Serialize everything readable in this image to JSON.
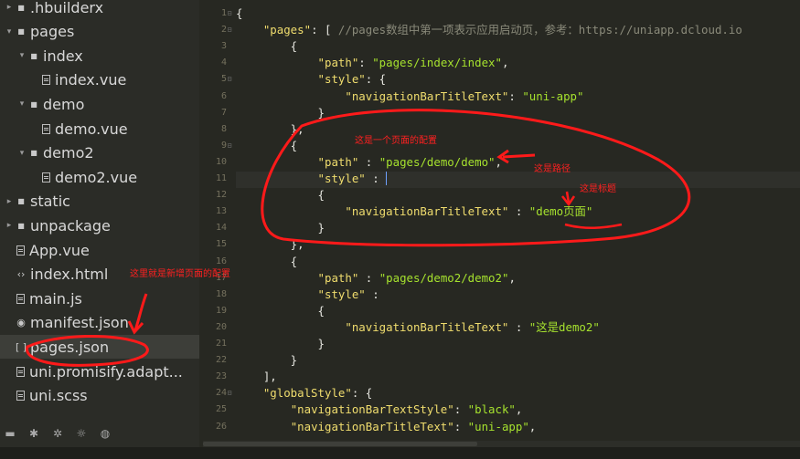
{
  "sidebar": {
    "items": [
      {
        "label": ".hbuilderx",
        "type": "folder",
        "expanded": false,
        "depth": 0
      },
      {
        "label": "pages",
        "type": "folder",
        "expanded": true,
        "depth": 0
      },
      {
        "label": "index",
        "type": "folder",
        "expanded": true,
        "depth": 1
      },
      {
        "label": "index.vue",
        "type": "file",
        "icon": "vue-file",
        "depth": 2
      },
      {
        "label": "demo",
        "type": "folder",
        "expanded": true,
        "depth": 1
      },
      {
        "label": "demo.vue",
        "type": "file",
        "icon": "vue-file",
        "depth": 2
      },
      {
        "label": "demo2",
        "type": "folder",
        "expanded": true,
        "depth": 1
      },
      {
        "label": "demo2.vue",
        "type": "file",
        "icon": "vue-file",
        "depth": 2
      },
      {
        "label": "static",
        "type": "folder",
        "expanded": false,
        "depth": 0
      },
      {
        "label": "unpackage",
        "type": "folder",
        "expanded": false,
        "depth": 0
      },
      {
        "label": "App.vue",
        "type": "file",
        "icon": "vue-file",
        "depth": 0
      },
      {
        "label": "index.html",
        "type": "file",
        "icon": "html-file",
        "depth": 0
      },
      {
        "label": "main.js",
        "type": "file",
        "icon": "js-file",
        "depth": 0
      },
      {
        "label": "manifest.json",
        "type": "file",
        "icon": "manifest-file",
        "depth": 0
      },
      {
        "label": "pages.json",
        "type": "file",
        "icon": "json-file",
        "depth": 0,
        "selected": true
      },
      {
        "label": "uni.promisify.adapt...",
        "type": "file",
        "icon": "js-file",
        "depth": 0
      },
      {
        "label": "uni.scss",
        "type": "file",
        "icon": "scss-file",
        "depth": 0
      }
    ],
    "bottom_icons": [
      "folder-icon",
      "bug-icon",
      "gear-icon",
      "sun-icon",
      "globe-icon"
    ]
  },
  "editor": {
    "line_numbers": [
      "1",
      "2",
      "3",
      "4",
      "5",
      "6",
      "7",
      "8",
      "9",
      "10",
      "11",
      "12",
      "13",
      "14",
      "15",
      "16",
      "17",
      "18",
      "19",
      "20",
      "21",
      "22",
      "23",
      "24",
      "25",
      "26"
    ],
    "folds": [
      "⊟",
      "⊟",
      "",
      "",
      "⊟",
      "",
      "",
      "",
      "⊟",
      "",
      "",
      "",
      "",
      "",
      "",
      "",
      "",
      "",
      "",
      "",
      "",
      "",
      "",
      "⊟",
      "",
      ""
    ],
    "lines": [
      [
        {
          "t": "p",
          "v": "{"
        }
      ],
      [
        {
          "t": "p",
          "v": "    "
        },
        {
          "t": "k",
          "v": "\"pages\""
        },
        {
          "t": "p",
          "v": ": [ "
        },
        {
          "t": "c",
          "v": "//pages数组中第一项表示应用启动页，参考：https://uniapp.dcloud.io"
        }
      ],
      [
        {
          "t": "p",
          "v": "        {"
        }
      ],
      [
        {
          "t": "p",
          "v": "            "
        },
        {
          "t": "k",
          "v": "\"path\""
        },
        {
          "t": "p",
          "v": ": "
        },
        {
          "t": "s",
          "v": "\"pages/index/index\""
        },
        {
          "t": "p",
          "v": ","
        }
      ],
      [
        {
          "t": "p",
          "v": "            "
        },
        {
          "t": "k",
          "v": "\"style\""
        },
        {
          "t": "p",
          "v": ": {"
        }
      ],
      [
        {
          "t": "p",
          "v": "                "
        },
        {
          "t": "k",
          "v": "\"navigationBarTitleText\""
        },
        {
          "t": "p",
          "v": ": "
        },
        {
          "t": "s",
          "v": "\"uni-app\""
        }
      ],
      [
        {
          "t": "p",
          "v": "            }"
        }
      ],
      [
        {
          "t": "p",
          "v": "        },"
        }
      ],
      [
        {
          "t": "p",
          "v": "        {"
        }
      ],
      [
        {
          "t": "p",
          "v": "            "
        },
        {
          "t": "k",
          "v": "\"path\""
        },
        {
          "t": "p",
          "v": " : "
        },
        {
          "t": "s",
          "v": "\"pages/demo/demo\""
        },
        {
          "t": "p",
          "v": ","
        }
      ],
      [
        {
          "t": "p",
          "v": "            "
        },
        {
          "t": "k",
          "v": "\"style\""
        },
        {
          "t": "p",
          "v": " : "
        },
        {
          "t": "caret",
          "v": ""
        }
      ],
      [
        {
          "t": "p",
          "v": "            {"
        }
      ],
      [
        {
          "t": "p",
          "v": "                "
        },
        {
          "t": "k",
          "v": "\"navigationBarTitleText\""
        },
        {
          "t": "p",
          "v": " : "
        },
        {
          "t": "s",
          "v": "\"demo页面\""
        }
      ],
      [
        {
          "t": "p",
          "v": "            }"
        }
      ],
      [
        {
          "t": "p",
          "v": "        },"
        }
      ],
      [
        {
          "t": "p",
          "v": "        {"
        }
      ],
      [
        {
          "t": "p",
          "v": "            "
        },
        {
          "t": "k",
          "v": "\"path\""
        },
        {
          "t": "p",
          "v": " : "
        },
        {
          "t": "s",
          "v": "\"pages/demo2/demo2\""
        },
        {
          "t": "p",
          "v": ","
        }
      ],
      [
        {
          "t": "p",
          "v": "            "
        },
        {
          "t": "k",
          "v": "\"style\""
        },
        {
          "t": "p",
          "v": " :"
        }
      ],
      [
        {
          "t": "p",
          "v": "            {"
        }
      ],
      [
        {
          "t": "p",
          "v": "                "
        },
        {
          "t": "k",
          "v": "\"navigationBarTitleText\""
        },
        {
          "t": "p",
          "v": " : "
        },
        {
          "t": "s",
          "v": "\"这是demo2\""
        }
      ],
      [
        {
          "t": "p",
          "v": "            }"
        }
      ],
      [
        {
          "t": "p",
          "v": "        }"
        }
      ],
      [
        {
          "t": "p",
          "v": "    ],"
        }
      ],
      [
        {
          "t": "p",
          "v": "    "
        },
        {
          "t": "k",
          "v": "\"globalStyle\""
        },
        {
          "t": "p",
          "v": ": {"
        }
      ],
      [
        {
          "t": "p",
          "v": "        "
        },
        {
          "t": "k",
          "v": "\"navigationBarTextStyle\""
        },
        {
          "t": "p",
          "v": ": "
        },
        {
          "t": "s",
          "v": "\"black\""
        },
        {
          "t": "p",
          "v": ","
        }
      ],
      [
        {
          "t": "p",
          "v": "        "
        },
        {
          "t": "k",
          "v": "\"navigationBarTitleText\""
        },
        {
          "t": "p",
          "v": ": "
        },
        {
          "t": "s",
          "v": "\"uni-app\""
        },
        {
          "t": "p",
          "v": ","
        }
      ]
    ]
  },
  "annotations": {
    "page_config_note": "这是一个页面的配置",
    "path_note": "这是路径",
    "title_note": "这是标题",
    "new_page_note": "这里就是新增页面的配置",
    "color": "#ff2020"
  }
}
